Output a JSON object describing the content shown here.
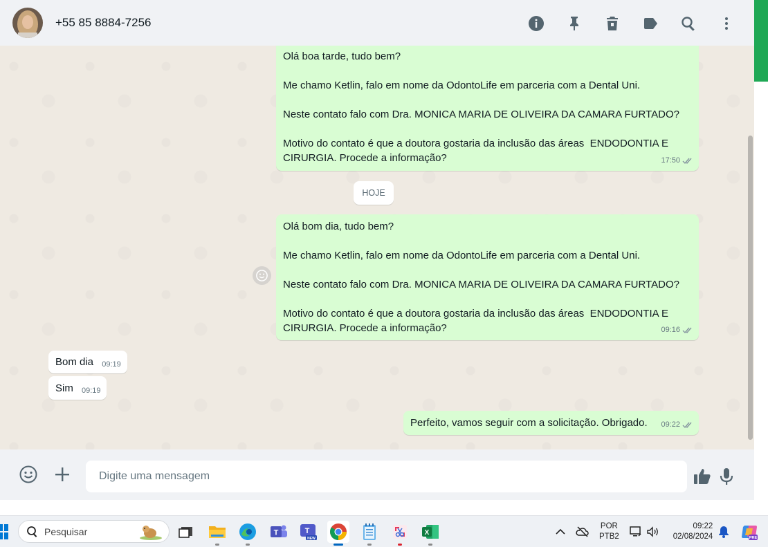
{
  "header": {
    "contact_name": "+55 85 8884-7256",
    "icons": [
      "info-icon",
      "pin-icon",
      "delete-icon",
      "label-icon",
      "search-icon",
      "menu-icon"
    ]
  },
  "colors": {
    "outgoing_bubble": "#d9fdd3",
    "incoming_bubble": "#ffffff",
    "chat_background": "#efeae2",
    "accent": "#1fa855"
  },
  "messages": [
    {
      "direction": "out",
      "text": "Olá boa tarde, tudo bem?\n\nMe chamo Ketlin, falo em nome da OdontoLife em parceria com a Dental Uni.\n\nNeste contato falo com Dra. MONICA MARIA DE OLIVEIRA DA CAMARA FURTADO?\n\nMotivo do contato é que a doutora gostaria da inclusão das áreas  ENDODONTIA E CIRURGIA. Procede a informação?",
      "time": "17:50"
    },
    {
      "direction": "date",
      "text": "HOJE"
    },
    {
      "direction": "out",
      "text": "Olá bom dia, tudo bem?\n\nMe chamo Ketlin, falo em nome da OdontoLife em parceria com a Dental Uni.\n\nNeste contato falo com Dra. MONICA MARIA DE OLIVEIRA DA CAMARA FURTADO?\n\nMotivo do contato é que a doutora gostaria da inclusão das áreas  ENDODONTIA E CIRURGIA. Procede a informação?",
      "time": "09:16"
    },
    {
      "direction": "in",
      "text": "Bom dia",
      "time": "09:19"
    },
    {
      "direction": "in",
      "text": "Sim",
      "time": "09:19"
    },
    {
      "direction": "out",
      "text": "Perfeito, vamos seguir com a solicitação. Obrigado.",
      "time": "09:22"
    }
  ],
  "composer": {
    "placeholder": "Digite uma mensagem",
    "icons": [
      "emoji-icon",
      "plus-icon",
      "thumbs-up-icon",
      "microphone-icon"
    ]
  },
  "taskbar": {
    "search_placeholder": "Pesquisar",
    "apps": [
      "task-view",
      "file-explorer",
      "edge",
      "teams",
      "teams-new",
      "chrome",
      "notepad",
      "snipping-tool",
      "excel"
    ],
    "language": "POR",
    "keyboard": "PTB2",
    "time": "09:22",
    "date": "02/08/2024"
  }
}
